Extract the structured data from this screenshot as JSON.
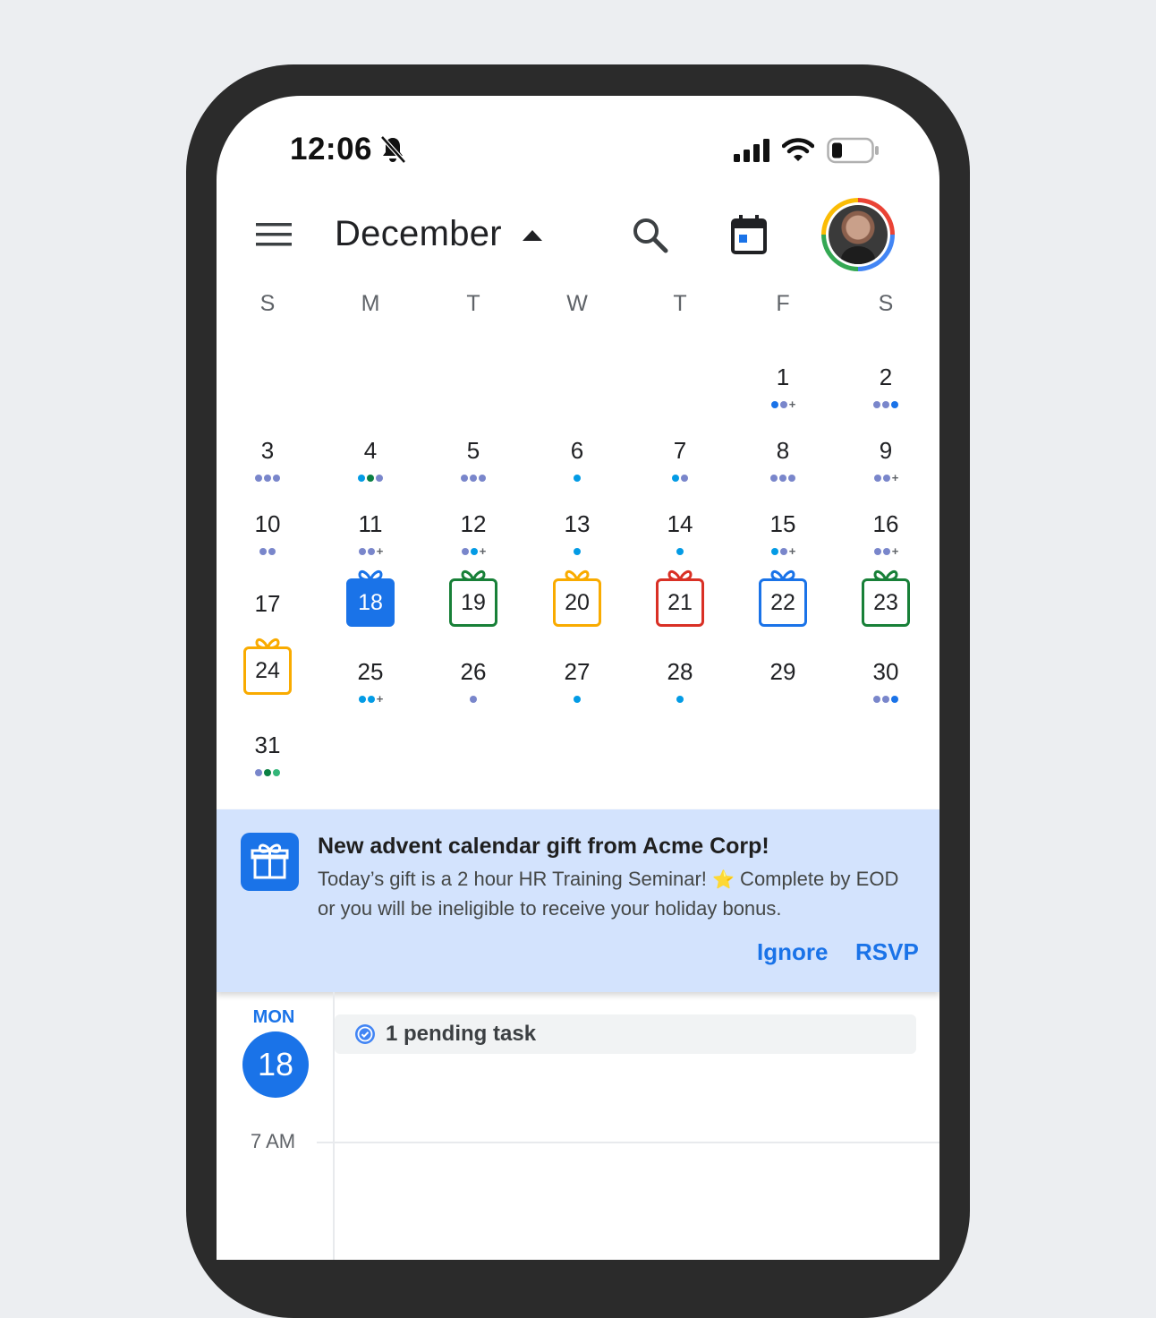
{
  "status_bar": {
    "time": "12:06"
  },
  "header": {
    "month": "December"
  },
  "weekdays": [
    "S",
    "M",
    "T",
    "W",
    "T",
    "F",
    "S"
  ],
  "days": [
    {
      "n": "1",
      "col": 5,
      "row": 0,
      "dots": [
        "#1a73e8",
        "#7986cb",
        "+"
      ]
    },
    {
      "n": "2",
      "col": 6,
      "row": 0,
      "dots": [
        "#7986cb",
        "#7986cb",
        "#1a73e8"
      ]
    },
    {
      "n": "3",
      "col": 0,
      "row": 1,
      "dots": [
        "#7986cb",
        "#7986cb",
        "#7986cb"
      ]
    },
    {
      "n": "4",
      "col": 1,
      "row": 1,
      "dots": [
        "#039be5",
        "#0b8043",
        "#7986cb"
      ]
    },
    {
      "n": "5",
      "col": 2,
      "row": 1,
      "dots": [
        "#7986cb",
        "#7986cb",
        "#7986cb"
      ]
    },
    {
      "n": "6",
      "col": 3,
      "row": 1,
      "dots": [
        "#039be5"
      ]
    },
    {
      "n": "7",
      "col": 4,
      "row": 1,
      "dots": [
        "#039be5",
        "#7986cb"
      ]
    },
    {
      "n": "8",
      "col": 5,
      "row": 1,
      "dots": [
        "#7986cb",
        "#7986cb",
        "#7986cb"
      ]
    },
    {
      "n": "9",
      "col": 6,
      "row": 1,
      "dots": [
        "#7986cb",
        "#7986cb",
        "+"
      ]
    },
    {
      "n": "10",
      "col": 0,
      "row": 2,
      "dots": [
        "#7986cb",
        "#7986cb"
      ]
    },
    {
      "n": "11",
      "col": 1,
      "row": 2,
      "dots": [
        "#7986cb",
        "#7986cb",
        "+"
      ]
    },
    {
      "n": "12",
      "col": 2,
      "row": 2,
      "dots": [
        "#7986cb",
        "#039be5",
        "+"
      ]
    },
    {
      "n": "13",
      "col": 3,
      "row": 2,
      "dots": [
        "#039be5"
      ]
    },
    {
      "n": "14",
      "col": 4,
      "row": 2,
      "dots": [
        "#039be5"
      ]
    },
    {
      "n": "15",
      "col": 5,
      "row": 2,
      "dots": [
        "#039be5",
        "#7986cb",
        "+"
      ]
    },
    {
      "n": "16",
      "col": 6,
      "row": 2,
      "dots": [
        "#7986cb",
        "#7986cb",
        "+"
      ]
    },
    {
      "n": "17",
      "col": 0,
      "row": 3,
      "dots": []
    },
    {
      "n": "25",
      "col": 1,
      "row": 4,
      "dots": [
        "#039be5",
        "#039be5",
        "+"
      ]
    },
    {
      "n": "26",
      "col": 2,
      "row": 4,
      "dots": [
        "#7986cb"
      ]
    },
    {
      "n": "27",
      "col": 3,
      "row": 4,
      "dots": [
        "#039be5"
      ]
    },
    {
      "n": "28",
      "col": 4,
      "row": 4,
      "dots": [
        "#039be5"
      ]
    },
    {
      "n": "29",
      "col": 5,
      "row": 4,
      "dots": []
    },
    {
      "n": "30",
      "col": 6,
      "row": 4,
      "dots": [
        "#7986cb",
        "#7986cb",
        "#1a73e8"
      ]
    },
    {
      "n": "31",
      "col": 0,
      "row": 5,
      "dots": [
        "#7986cb",
        "#0b8043",
        "#33b679"
      ]
    }
  ],
  "gift_days": [
    {
      "n": "18",
      "col": 1,
      "row": 3,
      "color": "#1a73e8",
      "today": true
    },
    {
      "n": "19",
      "col": 2,
      "row": 3,
      "color": "#188038",
      "today": false
    },
    {
      "n": "20",
      "col": 3,
      "row": 3,
      "color": "#f9ab00",
      "today": false
    },
    {
      "n": "21",
      "col": 4,
      "row": 3,
      "color": "#d93025",
      "today": false
    },
    {
      "n": "22",
      "col": 5,
      "row": 3,
      "color": "#1a73e8",
      "today": false
    },
    {
      "n": "23",
      "col": 6,
      "row": 3,
      "color": "#188038",
      "today": false
    },
    {
      "n": "24",
      "col": 0,
      "row": 4,
      "color": "#f9ab00",
      "today": false
    }
  ],
  "notification": {
    "title": "New advent calendar gift from Acme Corp!",
    "body_before_star": "Today’s gift is a 2 hour HR Training Seminar! ",
    "star": "⭐",
    "body_after_star": " Complete by EOD or you will be ineligible to receive your holiday bonus.",
    "ignore_label": "Ignore",
    "rsvp_label": "RSVP"
  },
  "day_view": {
    "weekday": "MON",
    "date": "18",
    "pending_task_label": "1 pending task",
    "first_hour": "7 AM"
  },
  "colors": {
    "accent": "#1a73e8",
    "banner": "#d3e3fd"
  }
}
